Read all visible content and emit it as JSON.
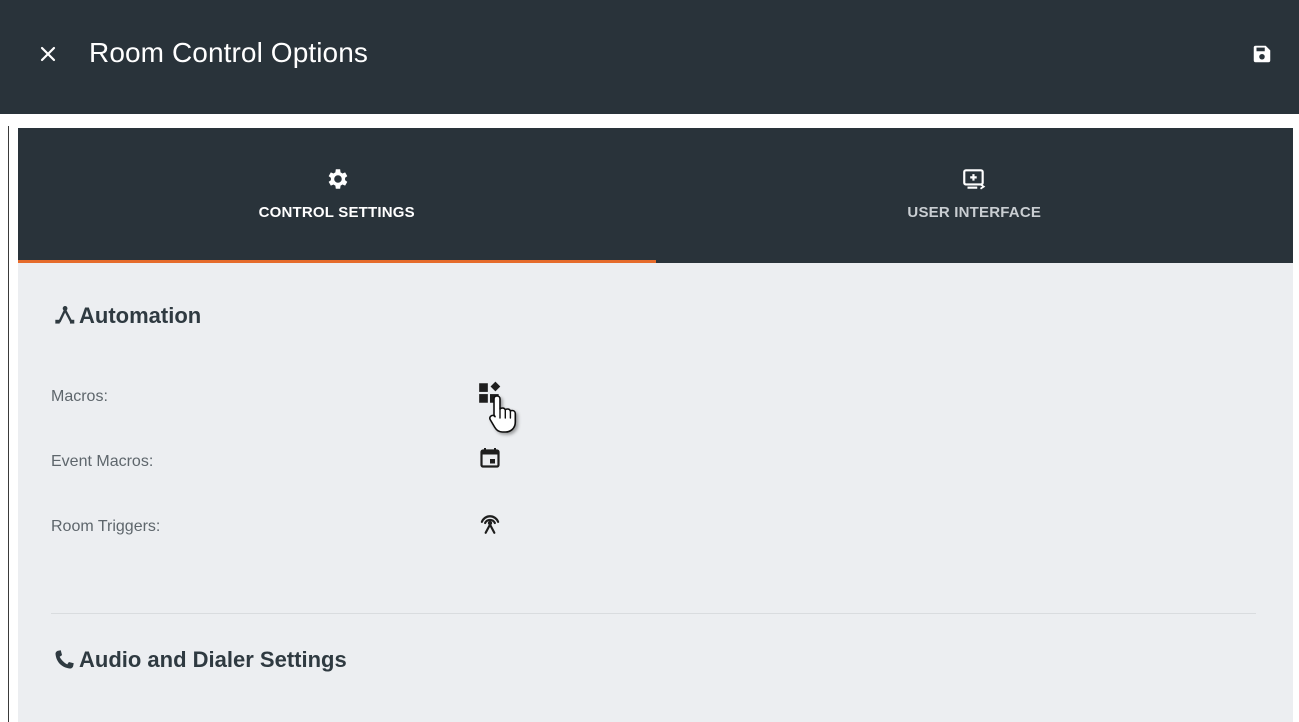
{
  "appbar": {
    "title": "Room Control Options",
    "close_icon": "close-icon",
    "save_icon": "floppy-disk-icon",
    "bg_color": "#29333a"
  },
  "tabs": [
    {
      "label": "CONTROL SETTINGS",
      "icon": "gear-icon",
      "active": true
    },
    {
      "label": "USER INTERFACE",
      "icon": "screen-add-icon",
      "active": false
    }
  ],
  "accent_color": "#e56b2c",
  "sections": {
    "automation": {
      "title": "Automation",
      "icon": "automation-fork-icon",
      "rows": [
        {
          "label": "Macros:",
          "icon": "widgets-icon"
        },
        {
          "label": "Event Macros:",
          "icon": "calendar-event-icon"
        },
        {
          "label": "Room Triggers:",
          "icon": "antenna-icon"
        }
      ]
    },
    "audio": {
      "title": "Audio and Dialer Settings",
      "icon": "phone-icon"
    }
  }
}
